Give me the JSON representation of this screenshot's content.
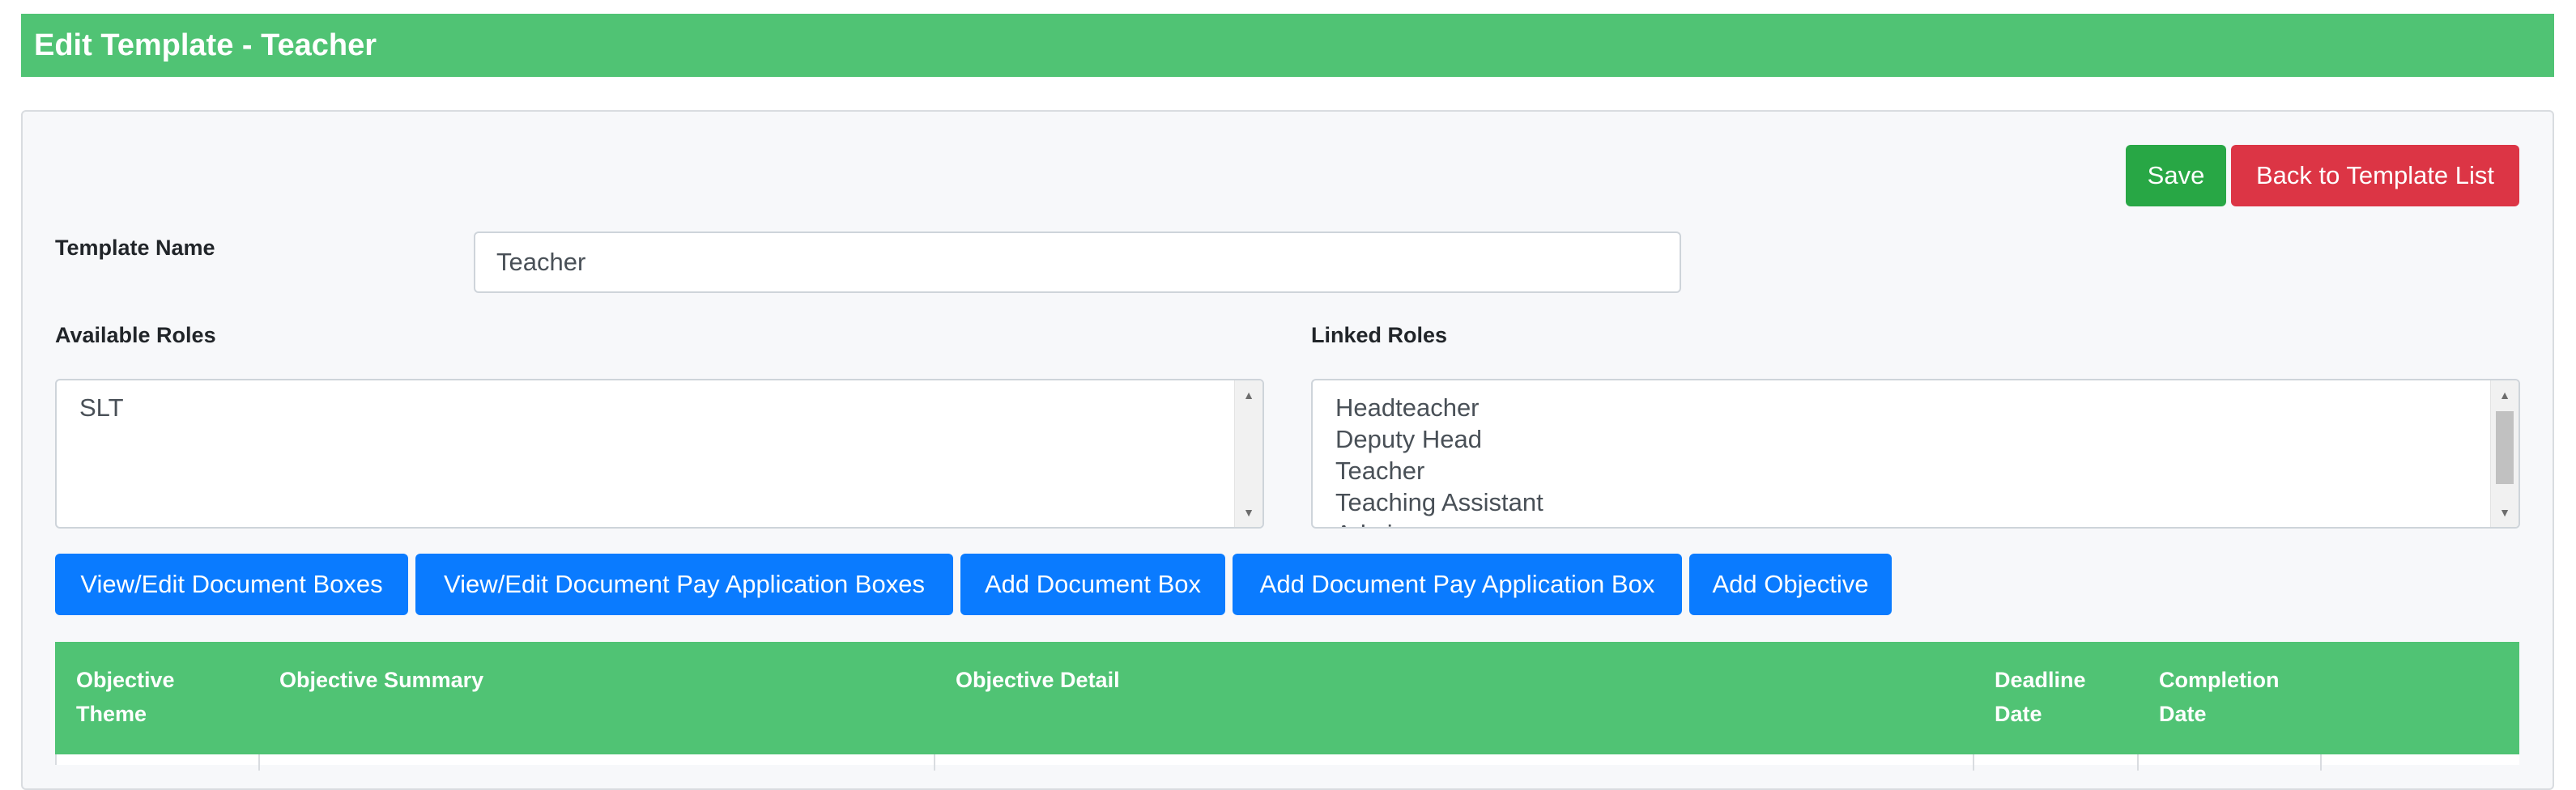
{
  "header": {
    "title": "Edit Template - Teacher"
  },
  "actions": {
    "save_label": "Save",
    "back_label": "Back to Template List"
  },
  "form": {
    "template_name_label": "Template Name",
    "template_name_value": "Teacher",
    "available_roles_label": "Available Roles",
    "linked_roles_label": "Linked Roles",
    "available_roles": [
      "SLT"
    ],
    "linked_roles": [
      "Headteacher",
      "Deputy Head",
      "Teacher",
      "Teaching Assistant",
      "Admin"
    ]
  },
  "toolbar": {
    "view_edit_doc_boxes": "View/Edit Document Boxes",
    "view_edit_doc_pay_boxes": "View/Edit Document Pay Application Boxes",
    "add_doc_box": "Add Document Box",
    "add_doc_pay_box": "Add Document Pay Application Box",
    "add_objective": "Add Objective"
  },
  "table": {
    "columns": [
      {
        "line1": "Objective",
        "line2": "Theme"
      },
      {
        "line1": "Objective Summary",
        "line2": ""
      },
      {
        "line1": "Objective Detail",
        "line2": ""
      },
      {
        "line1": "Deadline",
        "line2": "Date"
      },
      {
        "line1": "Completion",
        "line2": "Date"
      }
    ]
  }
}
